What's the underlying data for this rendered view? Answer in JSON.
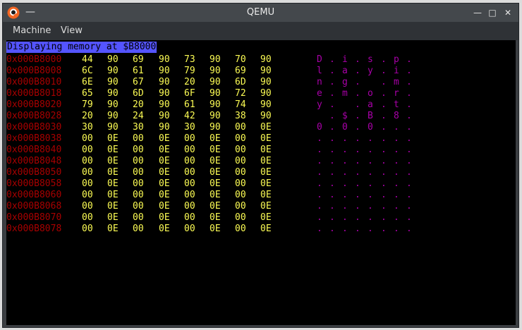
{
  "window": {
    "title": "QEMU",
    "collapse_glyph": "—",
    "minimize_glyph": "—",
    "maximize_glyph": "□",
    "close_glyph": "✕",
    "logo_icon": "qemu-logo-icon"
  },
  "menu": {
    "items": [
      "Machine",
      "View"
    ]
  },
  "screen": {
    "header": "Displaying memory at $B8000",
    "colors": {
      "address": "#a80000",
      "bytes": "#fcfc54",
      "chars": "#a800a8",
      "header_bg": "#5454ff"
    },
    "rows": [
      {
        "addr": "0x000B8000",
        "bytes": [
          "44",
          "90",
          "69",
          "90",
          "73",
          "90",
          "70",
          "90"
        ],
        "chars": [
          "D",
          ".",
          "i",
          ".",
          "s",
          ".",
          "p",
          "."
        ]
      },
      {
        "addr": "0x000B8008",
        "bytes": [
          "6C",
          "90",
          "61",
          "90",
          "79",
          "90",
          "69",
          "90"
        ],
        "chars": [
          "l",
          ".",
          "a",
          ".",
          "y",
          ".",
          "i",
          "."
        ]
      },
      {
        "addr": "0x000B8010",
        "bytes": [
          "6E",
          "90",
          "67",
          "90",
          "20",
          "90",
          "6D",
          "90"
        ],
        "chars": [
          "n",
          ".",
          "g",
          ".",
          " ",
          ".",
          "m",
          "."
        ]
      },
      {
        "addr": "0x000B8018",
        "bytes": [
          "65",
          "90",
          "6D",
          "90",
          "6F",
          "90",
          "72",
          "90"
        ],
        "chars": [
          "e",
          ".",
          "m",
          ".",
          "o",
          ".",
          "r",
          "."
        ]
      },
      {
        "addr": "0x000B8020",
        "bytes": [
          "79",
          "90",
          "20",
          "90",
          "61",
          "90",
          "74",
          "90"
        ],
        "chars": [
          "y",
          ".",
          " ",
          ".",
          "a",
          ".",
          "t",
          "."
        ]
      },
      {
        "addr": "0x000B8028",
        "bytes": [
          "20",
          "90",
          "24",
          "90",
          "42",
          "90",
          "38",
          "90"
        ],
        "chars": [
          " ",
          ".",
          "$",
          ".",
          "B",
          ".",
          "8",
          "."
        ]
      },
      {
        "addr": "0x000B8030",
        "bytes": [
          "30",
          "90",
          "30",
          "90",
          "30",
          "90",
          "00",
          "0E"
        ],
        "chars": [
          "0",
          ".",
          "0",
          ".",
          "0",
          ".",
          ".",
          "."
        ]
      },
      {
        "addr": "0x000B8038",
        "bytes": [
          "00",
          "0E",
          "00",
          "0E",
          "00",
          "0E",
          "00",
          "0E"
        ],
        "chars": [
          ".",
          ".",
          ".",
          ".",
          ".",
          ".",
          ".",
          "."
        ]
      },
      {
        "addr": "0x000B8040",
        "bytes": [
          "00",
          "0E",
          "00",
          "0E",
          "00",
          "0E",
          "00",
          "0E"
        ],
        "chars": [
          ".",
          ".",
          ".",
          ".",
          ".",
          ".",
          ".",
          "."
        ]
      },
      {
        "addr": "0x000B8048",
        "bytes": [
          "00",
          "0E",
          "00",
          "0E",
          "00",
          "0E",
          "00",
          "0E"
        ],
        "chars": [
          ".",
          ".",
          ".",
          ".",
          ".",
          ".",
          ".",
          "."
        ]
      },
      {
        "addr": "0x000B8050",
        "bytes": [
          "00",
          "0E",
          "00",
          "0E",
          "00",
          "0E",
          "00",
          "0E"
        ],
        "chars": [
          ".",
          ".",
          ".",
          ".",
          ".",
          ".",
          ".",
          "."
        ]
      },
      {
        "addr": "0x000B8058",
        "bytes": [
          "00",
          "0E",
          "00",
          "0E",
          "00",
          "0E",
          "00",
          "0E"
        ],
        "chars": [
          ".",
          ".",
          ".",
          ".",
          ".",
          ".",
          ".",
          "."
        ]
      },
      {
        "addr": "0x000B8060",
        "bytes": [
          "00",
          "0E",
          "00",
          "0E",
          "00",
          "0E",
          "00",
          "0E"
        ],
        "chars": [
          ".",
          ".",
          ".",
          ".",
          ".",
          ".",
          ".",
          "."
        ]
      },
      {
        "addr": "0x000B8068",
        "bytes": [
          "00",
          "0E",
          "00",
          "0E",
          "00",
          "0E",
          "00",
          "0E"
        ],
        "chars": [
          ".",
          ".",
          ".",
          ".",
          ".",
          ".",
          ".",
          "."
        ]
      },
      {
        "addr": "0x000B8070",
        "bytes": [
          "00",
          "0E",
          "00",
          "0E",
          "00",
          "0E",
          "00",
          "0E"
        ],
        "chars": [
          ".",
          ".",
          ".",
          ".",
          ".",
          ".",
          ".",
          "."
        ]
      },
      {
        "addr": "0x000B8078",
        "bytes": [
          "00",
          "0E",
          "00",
          "0E",
          "00",
          "0E",
          "00",
          "0E"
        ],
        "chars": [
          ".",
          ".",
          ".",
          ".",
          ".",
          ".",
          ".",
          "."
        ]
      }
    ]
  }
}
